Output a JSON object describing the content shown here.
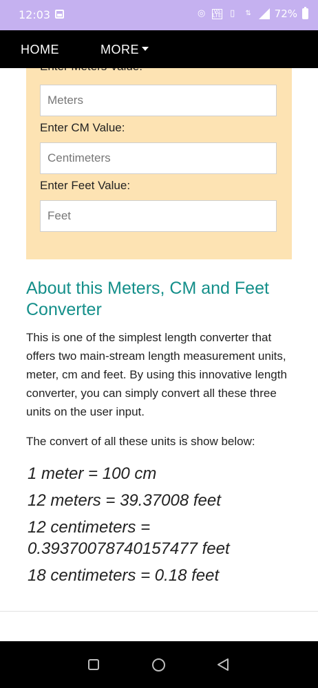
{
  "status_bar": {
    "time": "12:03",
    "battery_text": "72%",
    "icons": [
      "image-icon",
      "hotspot-icon",
      "volte-icon",
      "vibrate-icon",
      "data-arrows-icon",
      "signal-icon",
      "battery-icon"
    ]
  },
  "nav": {
    "home_label": "HOME",
    "more_label": "MORE"
  },
  "converter": {
    "meters_label": "Enter Meters Value:",
    "meters_placeholder": "Meters",
    "cm_label": "Enter CM Value:",
    "cm_placeholder": "Centimeters",
    "feet_label": "Enter Feet Value:",
    "feet_placeholder": "Feet"
  },
  "about": {
    "title": "About this Meters, CM and Feet Converter",
    "paragraph": "This is one of the simplest length converter that offers two main-stream length measurement units, meter, cm and feet. By using this innovative length converter, you can simply convert all these three units on the user input.",
    "intro": "The convert of all these units is show below:",
    "examples": [
      "1 meter = 100 cm",
      "12 meters = 39.37008 feet",
      "12 centimeters = 0.39370078740157477 feet",
      "18 centimeters = 0.18 feet"
    ]
  },
  "colors": {
    "status_bar": "#c5b1f0",
    "navbar": "#000000",
    "card": "#fde3b3",
    "heading": "#148f8a"
  }
}
